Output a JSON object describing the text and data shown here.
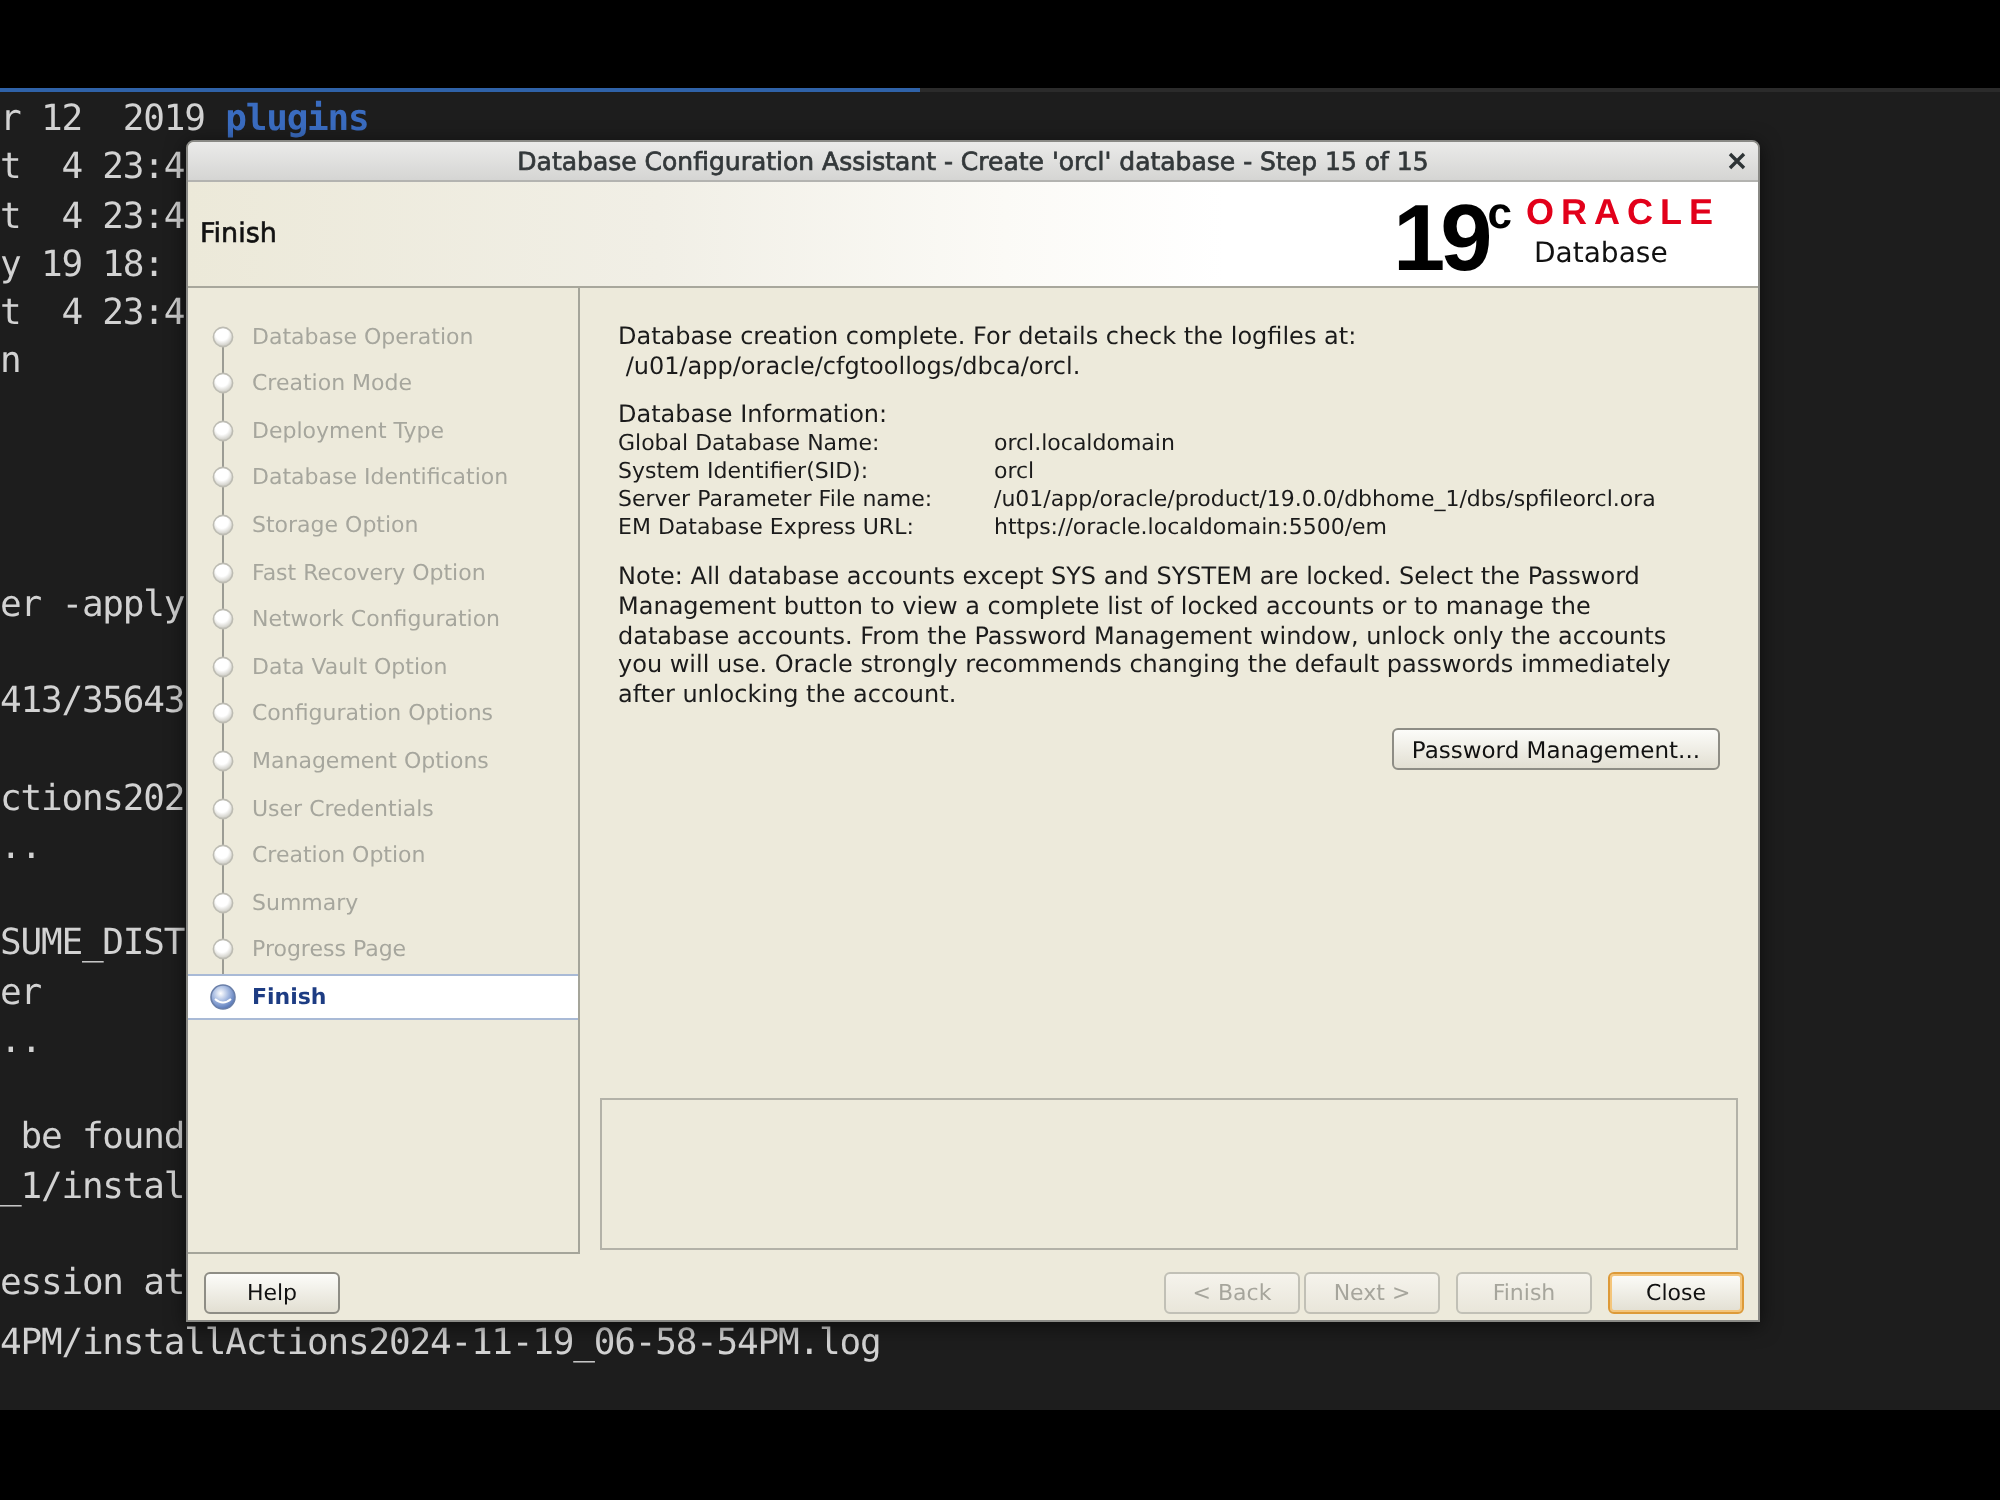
{
  "terminal": {
    "blocks": [
      [
        {
          "text": "r 12  2019",
          "directory": "plugins"
        },
        {
          "text": "t  4 23:4"
        },
        {
          "text": "t  4 23:4"
        },
        {
          "text": "y 19 18:"
        },
        {
          "text": "t  4 23:4"
        },
        {
          "text": "n"
        }
      ],
      [
        {
          "text": "er -apply"
        }
      ],
      [
        {
          "text": "413/35643"
        }
      ],
      [
        {
          "text": "ctions202"
        },
        {
          "text": ".."
        }
      ],
      [
        {
          "text": "SUME_DIST"
        },
        {
          "text": "er"
        },
        {
          "text": ".."
        }
      ],
      [
        {
          "text": " be found"
        },
        {
          "text": "_1/instal"
        }
      ],
      [
        {
          "text": "ession at"
        },
        {
          "text": "4PM/installActions2024-11-19_06-58-54PM.log"
        }
      ]
    ]
  },
  "dialog": {
    "title": "Database Configuration Assistant - Create 'orcl' database - Step 15 of 15",
    "header": {
      "title": "Finish",
      "version": "19$^{c}$",
      "brand": "ORACLE",
      "product": "Database"
    },
    "steps": [
      {
        "label": "Database Operation",
        "selected": false
      },
      {
        "label": "Creation Mode",
        "selected": false
      },
      {
        "label": "Deployment Type",
        "selected": false
      },
      {
        "label": "Database Identification",
        "selected": false
      },
      {
        "label": "Storage Option",
        "selected": false
      },
      {
        "label": "Fast Recovery Option",
        "selected": false
      },
      {
        "label": "Network Configuration",
        "selected": false
      },
      {
        "label": "Data Vault Option",
        "selected": false
      },
      {
        "label": "Configuration Options",
        "selected": false
      },
      {
        "label": "Management Options",
        "selected": false
      },
      {
        "label": "User Credentials",
        "selected": false
      },
      {
        "label": "Creation Option",
        "selected": false
      },
      {
        "label": "Summary",
        "selected": false
      },
      {
        "label": "Progress Page",
        "selected": false
      },
      {
        "label": "Finish",
        "selected": true
      }
    ],
    "message": "Database creation complete. For details check the logfiles at:\n /u01/app/oracle/cfgtoollogs/dbca/orcl.",
    "info_heading": "Database Information:",
    "info": [
      {
        "label": "Global Database Name:",
        "value": "orcl.localdomain"
      },
      {
        "label": "System Identifier(SID):",
        "value": "orcl"
      },
      {
        "label": "Server Parameter File name:",
        "value": "/u01/app/oracle/product/19.0.0/dbhome_1/dbs/spfileorcl.ora"
      },
      {
        "label": "EM Database Express URL:",
        "value": "https://oracle.localdomain:5500/em"
      }
    ],
    "note": "Note: All database accounts except SYS and SYSTEM are locked. Select the Password Management button to view a complete list of locked accounts or to manage the database accounts. From the Password Management window, unlock only the accounts you will use. Oracle strongly recommends changing the default passwords immediately after unlocking the account.",
    "password_button": {
      "label": "Password Management..."
    },
    "help_button": {
      "label": "Help"
    },
    "nav_buttons": [
      {
        "label": "< Back",
        "disabled": true,
        "default": false
      },
      {
        "label": "Next >",
        "disabled": true,
        "default": false
      },
      {
        "label": "Finish",
        "disabled": true,
        "default": false
      },
      {
        "label": "Close",
        "disabled": false,
        "default": true
      }
    ]
  }
}
